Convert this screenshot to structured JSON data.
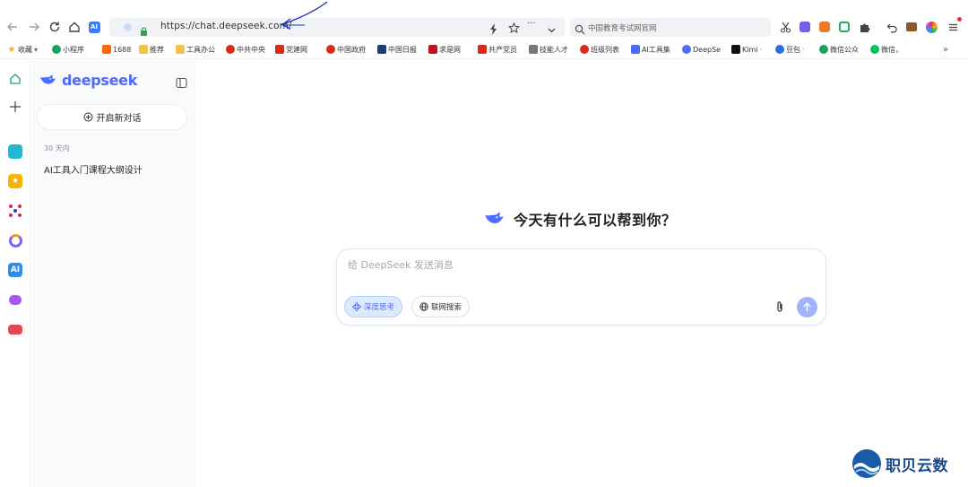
{
  "browser": {
    "url": "https://chat.deepseek.com/",
    "search_placeholder": "中国教育考试网官网",
    "menu_dots": "···"
  },
  "bookmarks": [
    {
      "label": "收藏",
      "icon": "star-icon",
      "color": "#f5a623"
    },
    {
      "label": "小程序",
      "icon": "mini-program-icon",
      "color": "#19a15f"
    },
    {
      "label": "1688",
      "icon": "1688-icon",
      "color": "#ff6a00"
    },
    {
      "label": "推荐",
      "icon": "folder-icon",
      "color": "#f2c14e"
    },
    {
      "label": "工具办公",
      "icon": "folder-icon",
      "color": "#f2c14e"
    },
    {
      "label": "中共中央",
      "icon": "emblem-icon",
      "color": "#d62c1a"
    },
    {
      "label": "党建网",
      "icon": "party-icon",
      "color": "#d62c1a"
    },
    {
      "label": "中国政府",
      "icon": "emblem-icon",
      "color": "#d62c1a"
    },
    {
      "label": "中国日报",
      "icon": "chinadaily-icon",
      "color": "#1f3b7a"
    },
    {
      "label": "求是网",
      "icon": "qiushi-icon",
      "color": "#c1121f"
    },
    {
      "label": "共产党员",
      "icon": "party-icon",
      "color": "#d62c1a"
    },
    {
      "label": "技能人才",
      "icon": "skill-icon",
      "color": "#555555"
    },
    {
      "label": "班级列表",
      "icon": "class-icon",
      "color": "#d62c1a"
    },
    {
      "label": "AI工具集",
      "icon": "ai-tools-icon",
      "color": "#4d6bfe"
    },
    {
      "label": "DeepSe",
      "icon": "deepseek-icon",
      "color": "#4d6bfe"
    },
    {
      "label": "Kimi",
      "icon": "kimi-icon",
      "color": "#111111"
    },
    {
      "label": "豆包",
      "icon": "doubao-icon",
      "color": "#2d6cdf"
    },
    {
      "label": "微信公众",
      "icon": "wechat-mp-icon",
      "color": "#19a15f"
    },
    {
      "label": "微信，",
      "icon": "wechat-icon",
      "color": "#07c160"
    }
  ],
  "sidebar": {
    "logo": "deepseek",
    "new_chat": "开启新对话",
    "date_group": "30 天内",
    "history": [
      "AI工具入门课程大纲设计"
    ]
  },
  "main": {
    "greeting": "今天有什么可以帮到你？",
    "placeholder": "给 DeepSeek 发送消息",
    "deep_think": "深度思考",
    "web_search": "联网搜索"
  },
  "watermark": "职贝云数",
  "colors": {
    "brand": "#4d6bfe",
    "send_disabled": "#9fb5fb",
    "chip_active_bg": "#dbeafe"
  }
}
